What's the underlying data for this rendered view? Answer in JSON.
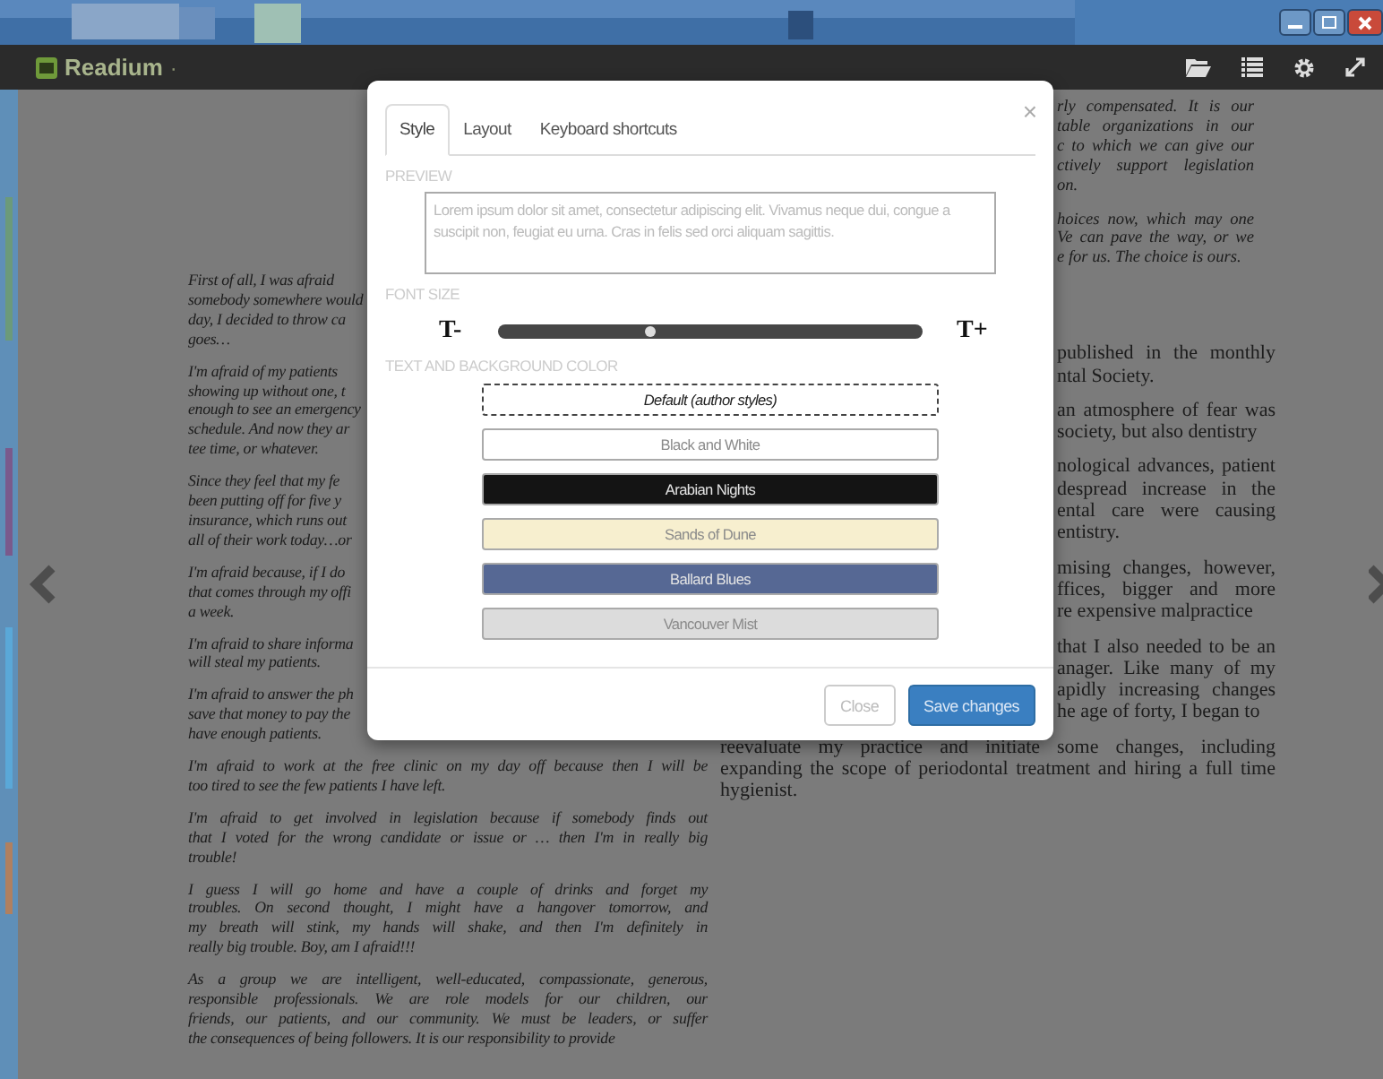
{
  "app": {
    "title": "Readium",
    "dot": "·"
  },
  "book": {
    "left_column": [
      {
        "italic": true,
        "cut": true,
        "lines": [
          "First of all, I was afraid",
          "somebody somewhere would",
          "day, I decided to throw ca",
          "goes…"
        ]
      },
      {
        "italic": true,
        "cut": true,
        "lines": [
          "I'm afraid of my patients",
          "showing up without one, t",
          "enough to see an emergency",
          "schedule. And now they ar",
          "tee time, or whatever."
        ]
      },
      {
        "italic": true,
        "cut": true,
        "lines": [
          "Since they feel that my fe",
          "been putting off for five y",
          "insurance, which runs out",
          "all of their work today…or"
        ]
      },
      {
        "italic": true,
        "cut": true,
        "lines": [
          "I'm afraid because, if I do",
          "that comes through my offi",
          "a week."
        ]
      },
      {
        "italic": true,
        "cut": true,
        "lines": [
          "I'm afraid to share informa",
          "will steal my patients."
        ]
      },
      {
        "italic": true,
        "cut": true,
        "lines": [
          "I'm afraid to answer the ph",
          "save that money to pay the",
          "have enough patients."
        ]
      },
      {
        "italic": true,
        "cut": false,
        "lines": [
          "I'm afraid to work at the free clinic on my day off because then I will be",
          "too tired to see the few patients I have left."
        ]
      },
      {
        "italic": true,
        "cut": false,
        "lines": [
          "I'm afraid to get involved in legislation because if somebody finds out",
          "that I voted for the wrong candidate or issue or … then I'm in really big",
          "trouble!"
        ]
      },
      {
        "italic": true,
        "cut": false,
        "lines": [
          "I guess I will go home and have a couple of drinks and forget my",
          "troubles. On second thought, I might have a hangover tomorrow, and",
          "my breath will stink, my hands will shake, and then I'm definitely in",
          "really big trouble. Boy, am I afraid!!!"
        ]
      },
      {
        "italic": true,
        "cut": false,
        "lines": [
          "As a group we are intelligent, well-educated, compassionate, generous,",
          "responsible professionals. We are role models for our children, our",
          "friends, our patients, and our community. We must be leaders, or suffer",
          "the consequences of being followers. It is our responsibility to provide"
        ]
      }
    ],
    "right_notes": [
      {
        "italic": true,
        "cut": true,
        "lines": [
          "rly compensated. It is our",
          "table organizations in our",
          "c to which we can give our",
          "ctively support legislation",
          "on."
        ]
      },
      {
        "italic": true,
        "cut": true,
        "lines": [
          "hoices now, which may one",
          "Ve can pave the way, or we",
          "e for us. The choice is ours."
        ]
      }
    ],
    "right_column": [
      {
        "italic": false,
        "cut": true,
        "lines": [
          "published in the monthly",
          "ntal Society."
        ]
      },
      {
        "italic": false,
        "cut": true,
        "lines": [
          "an atmosphere of fear was",
          "society, but also dentistry"
        ]
      },
      {
        "italic": false,
        "cut": true,
        "lines": [
          "nological advances, patient",
          "despread increase in the",
          "ental care were causing",
          "entistry."
        ]
      },
      {
        "italic": false,
        "cut": true,
        "lines": [
          "mising changes, however,",
          "ffices, bigger and more",
          "re expensive malpractice"
        ]
      },
      {
        "italic": false,
        "cut": true,
        "lines": [
          "that I also needed to be an",
          "anager. Like many of my",
          "apidly increasing changes",
          "he age of forty, I began to"
        ]
      },
      {
        "italic": false,
        "cut": false,
        "lines": [
          "reevaluate my practice and initiate some changes, including",
          "expanding the scope of periodontal treatment and hiring a full time",
          "hygienist."
        ]
      }
    ]
  },
  "dialog": {
    "close": "×",
    "tabs": [
      {
        "label": "Style",
        "selected": true
      },
      {
        "label": "Layout",
        "selected": false
      },
      {
        "label": "Keyboard shortcuts",
        "selected": false
      }
    ],
    "preview_label": "PREVIEW",
    "preview_text": "Lorem ipsum dolor sit amet, consectetur adipiscing elit. Vivamus neque dui, congue a suscipit non, feugiat eu urna. Cras in felis sed orci aliquam sagittis.",
    "font_size_label": "FONT SIZE",
    "font_smaller": "T-",
    "font_larger": "T+",
    "font_size": {
      "level": 0.36
    },
    "color_label": "TEXT AND BACKGROUND COLOR",
    "themes": [
      {
        "kind": "default",
        "label": "Default (author styles)",
        "color": "#ffffff"
      },
      {
        "kind": "theme",
        "label": "Black and White",
        "color": "#ffffff"
      },
      {
        "kind": "theme",
        "label": "Arabian Nights",
        "color": "#141414"
      },
      {
        "kind": "theme",
        "label": "Sands of Dune",
        "color": "#f7efcf"
      },
      {
        "kind": "theme",
        "label": "Ballard Blues",
        "color": "#566894"
      },
      {
        "kind": "theme",
        "label": "Vancouver Mist",
        "color": "#dcdcdc"
      }
    ],
    "buttons": [
      {
        "kind": "secondary",
        "label": "Close"
      },
      {
        "kind": "primary",
        "label": "Save changes"
      }
    ]
  }
}
